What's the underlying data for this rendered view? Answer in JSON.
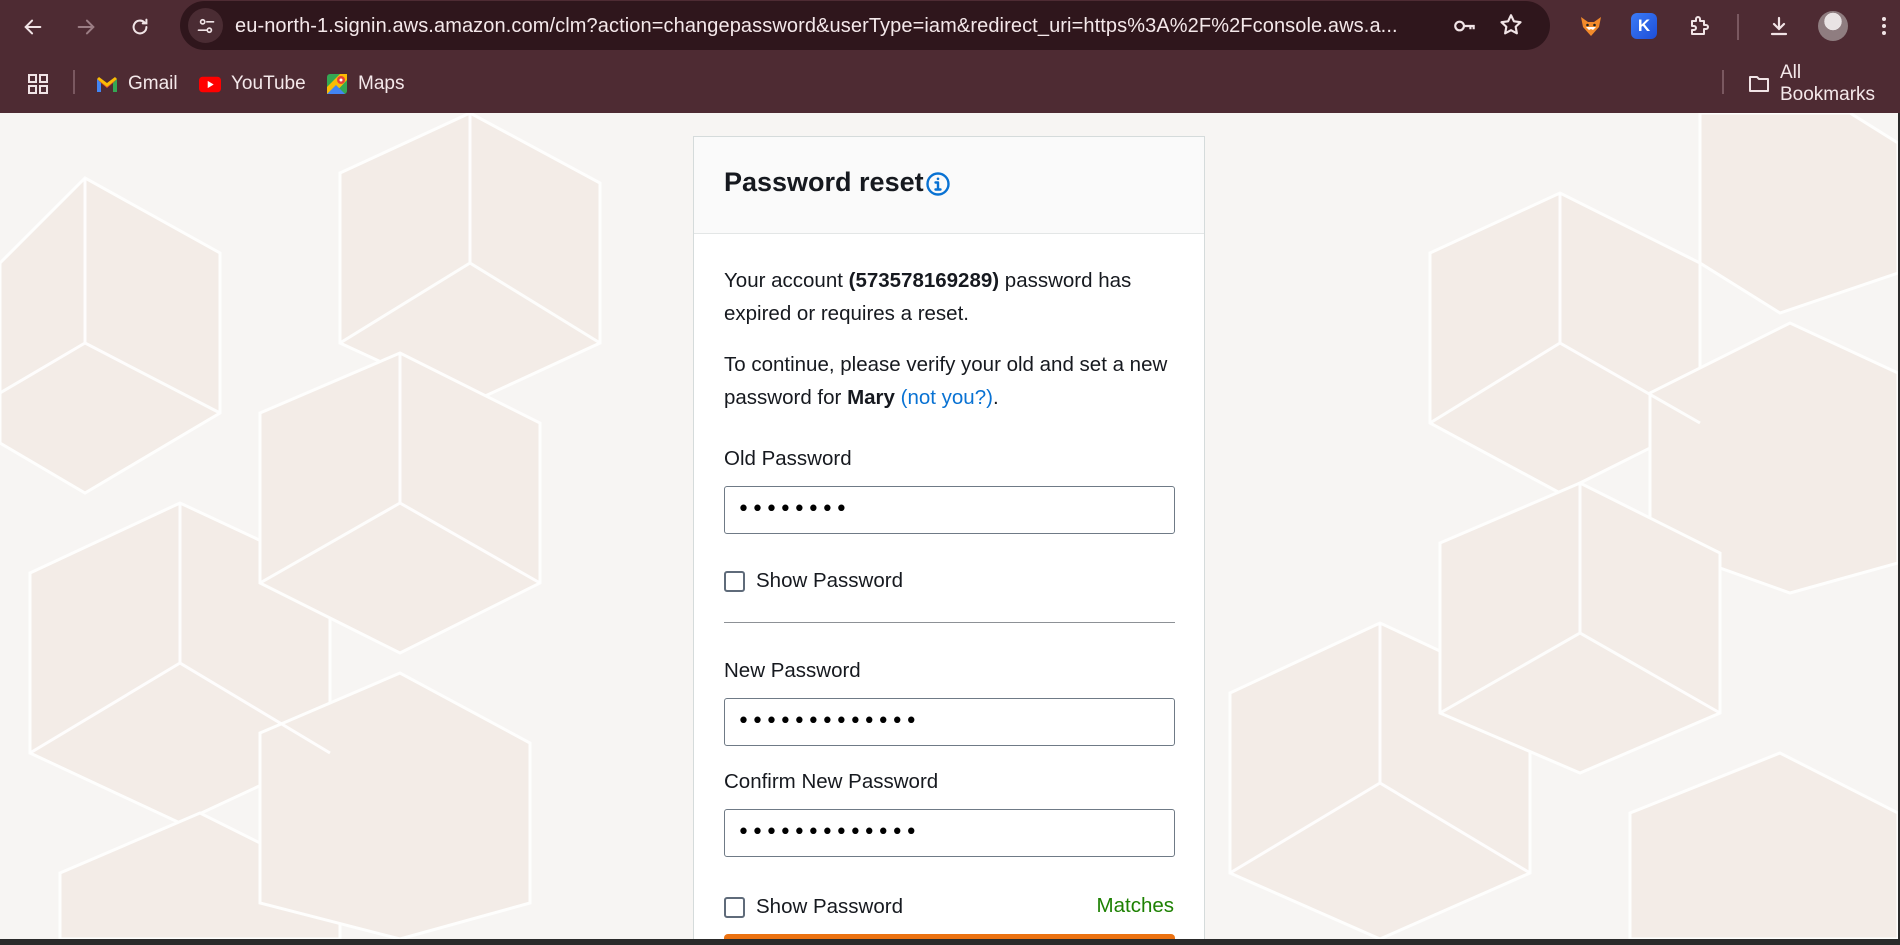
{
  "browser": {
    "url": "eu-north-1.signin.aws.amazon.com/clm?action=changepassword&userType=iam&redirect_uri=https%3A%2F%2Fconsole.aws.a...",
    "extension_k_label": "K",
    "bookmarks": [
      {
        "label": "Gmail",
        "icon": "gmail-icon"
      },
      {
        "label": "YouTube",
        "icon": "youtube-icon"
      },
      {
        "label": "Maps",
        "icon": "maps-icon"
      }
    ],
    "all_bookmarks_label": "All Bookmarks",
    "colors": {
      "frame": "#4e2b33",
      "omnibox": "#2f161c"
    }
  },
  "card": {
    "title": "Password reset",
    "intro_prefix": "Your account ",
    "account_id": "(573578169289)",
    "intro_suffix": " password has expired or requires a reset.",
    "continue_text": "To continue, please verify your old and set a new password for ",
    "user_name": "Mary",
    "not_you_link": "(not you?)",
    "period": ".",
    "old_password_label": "Old Password",
    "old_password_value": "••••••••",
    "show_password_label": "Show Password",
    "new_password_label": "New Password",
    "new_password_value": "•••••••••••••",
    "confirm_password_label": "Confirm New Password",
    "confirm_password_value": "•••••••••••••",
    "show_password_label_2": "Show Password",
    "matches_text": "Matches",
    "colors": {
      "link": "#0972d3",
      "success": "#1d8102",
      "primary_button": "#ec7211"
    }
  }
}
